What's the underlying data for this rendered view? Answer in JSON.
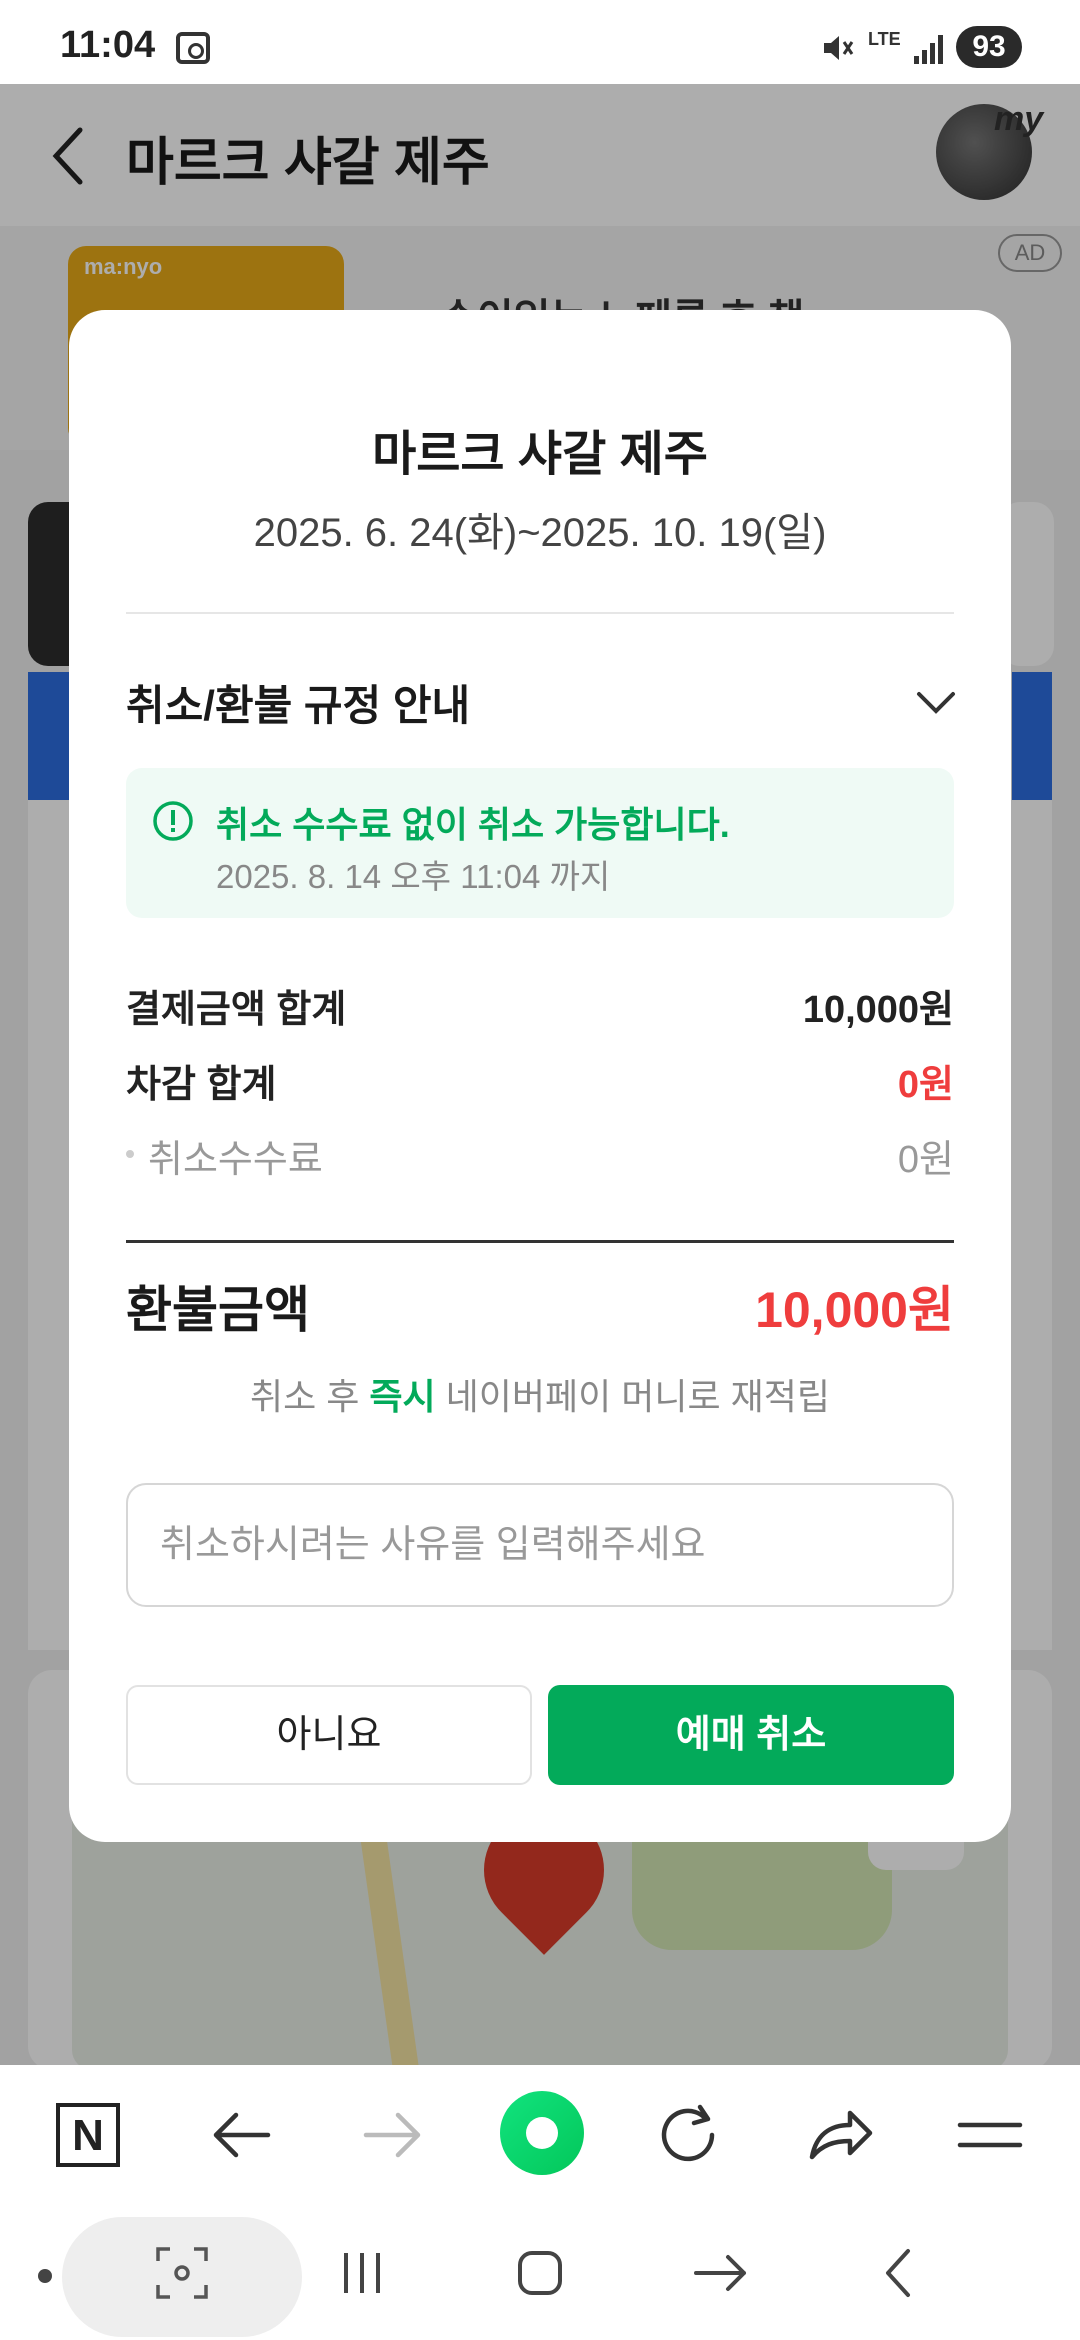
{
  "status_bar": {
    "time": "11:04",
    "network": "LTE",
    "battery": "93"
  },
  "background": {
    "title": "마르크 샤갈 제주",
    "avatar_tag": "my",
    "ad": {
      "brand": "ma:nyo",
      "badge": "AD",
      "text": "손이있는 노페른 호 책"
    }
  },
  "modal": {
    "title": "마르크 샤갈 제주",
    "dates": "2025. 6. 24(화)~2025. 10. 19(일)",
    "section_title": "취소/환불 규정 안내",
    "notice": {
      "text": "취소 수수료 없이 취소 가능합니다.",
      "deadline": "2025. 8. 14 오후 11:04 까지"
    },
    "rows": [
      {
        "label": "결제금액 합계",
        "value": "10,000원"
      },
      {
        "label": "차감 합계",
        "value": "0원"
      },
      {
        "label": "취소수수료",
        "value": "0원"
      }
    ],
    "refund": {
      "label": "환불금액",
      "value": "10,000원"
    },
    "note": {
      "pre": "취소 후 ",
      "highlight": "즉시",
      "post": " 네이버페이 머니로 재적립"
    },
    "reason_input": {
      "placeholder": "취소하시려는 사유를 입력해주세요",
      "value": ""
    },
    "buttons": {
      "no": "아니요",
      "confirm": "예매 취소"
    }
  },
  "toolbar": {
    "home_label": "N"
  },
  "colors": {
    "accent_green": "#03aa5a",
    "red": "#ef3d3d",
    "notice_bg": "#effaf5"
  }
}
